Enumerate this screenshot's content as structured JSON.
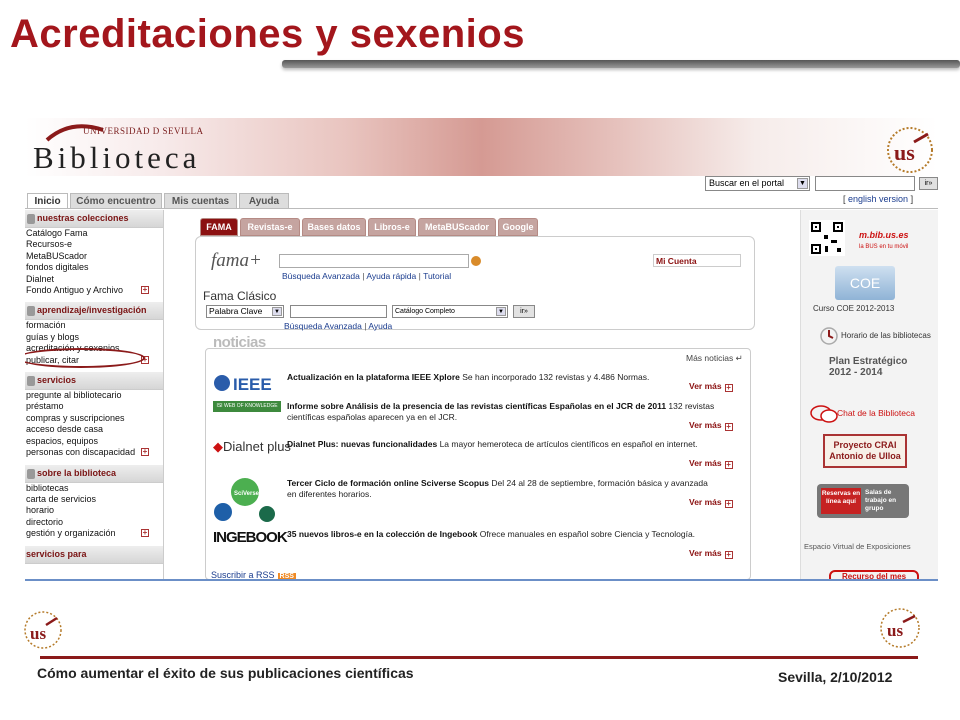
{
  "slide": {
    "title": "Acreditaciones y sexenios",
    "footer_left": "Cómo aumentar el éxito de sus publicaciones científicas",
    "footer_right": "Sevilla, 2/10/2012"
  },
  "banner": {
    "university": "UNIVERSIDAD D SEVILLA",
    "library": "Biblioteca"
  },
  "top_search": {
    "scope_select": "Buscar en el portal",
    "go_label": "ir»",
    "lang_prefix": "[ ",
    "lang_link": "english version",
    "lang_suffix": " ]"
  },
  "tabs": [
    "Inicio",
    "Cómo encuentro",
    "Mis cuentas",
    "Ayuda"
  ],
  "sidebar": {
    "colecciones": {
      "heading": "nuestras colecciones",
      "items": [
        "Catálogo Fama",
        "Recursos-e",
        "MetaBUScador",
        "fondos digitales",
        "Dialnet",
        "Fondo Antiguo y Archivo"
      ]
    },
    "aprendizaje": {
      "heading": "aprendizaje/investigación",
      "items": [
        "formación",
        "guías y blogs",
        "acreditación y sexenios",
        "publicar, citar"
      ]
    },
    "servicios": {
      "heading": "servicios",
      "items": [
        "pregunte al bibliotecario",
        "préstamo",
        "compras y suscripciones",
        "acceso desde casa",
        "espacios, equipos",
        "personas con discapacidad"
      ]
    },
    "sobre": {
      "heading": "sobre la biblioteca",
      "items": [
        "bibliotecas",
        "carta de servicios",
        "horario",
        "directorio",
        "gestión y organización"
      ]
    },
    "servicios_para": {
      "heading": "servicios para"
    }
  },
  "fama": {
    "tabs": [
      "FAMA",
      "Revistas-e",
      "Bases datos",
      "Libros-e",
      "MetaBUScador",
      "Google"
    ],
    "logo": "fama+",
    "links": [
      "Búsqueda Avanzada",
      "Ayuda rápida",
      "Tutorial"
    ],
    "mi_cuenta": "Mi Cuenta",
    "clasico_title": "Fama Clásico",
    "field_select": "Palabra Clave",
    "catalog_select": "Catálogo Completo",
    "clasico_links": [
      "Búsqueda Avanzada",
      "Ayuda"
    ],
    "go_label": "ir»"
  },
  "news": {
    "heading": "noticias",
    "mas": "Más noticias",
    "ver_mas": "Ver más",
    "items": [
      {
        "logo": "IEEE",
        "title": "Actualización en la plataforma IEEE Xplore",
        "text": " Se han incorporado 132 revistas y 4.486 Normas."
      },
      {
        "logo": "ISI WEB OF KNOWLEDGE",
        "title": "Informe sobre Análisis de la presencia de las revistas científicas Españolas en el JCR de 2011",
        "text": " 132 revistas científicas españolas aparecen ya en el JCR."
      },
      {
        "logo": "Dialnet plus",
        "title": "Dialnet Plus: nuevas funcionalidades",
        "text": " La mayor hemeroteca de artículos científicos en español en internet."
      },
      {
        "logo": "SciVerse",
        "title": "Tercer Ciclo de formación online Sciverse Scopus",
        "text": " Del 24 al 28 de septiembre, formación básica y avanzada en diferentes horarios."
      },
      {
        "logo": "INGEBOOK",
        "title": "35 nuevos libros-e en la colección de Ingebook",
        "text": " Ofrece manuales en español sobre Ciencia y Tecnología."
      }
    ],
    "rss": "Suscribir a RSS",
    "rss_badge": "RSS"
  },
  "right": {
    "mbib": "m.bib.us.es",
    "mbib_sub": "la BUS en tu móvil",
    "coe": "COE",
    "coe_caption": "Curso COE 2012-2013",
    "horario": "Horario de las bibliotecas",
    "plan": "Plan Estratégico 2012 - 2014",
    "chat": "Chat de la Biblioteca",
    "crai": "Proyecto CRAI Antonio de Ulloa",
    "reservas": "Reservas en línea aquí",
    "salas": "Salas de trabajo en grupo",
    "espacio": "Espacio Virtual de Exposiciones",
    "recurso": "Recurso del mes"
  }
}
